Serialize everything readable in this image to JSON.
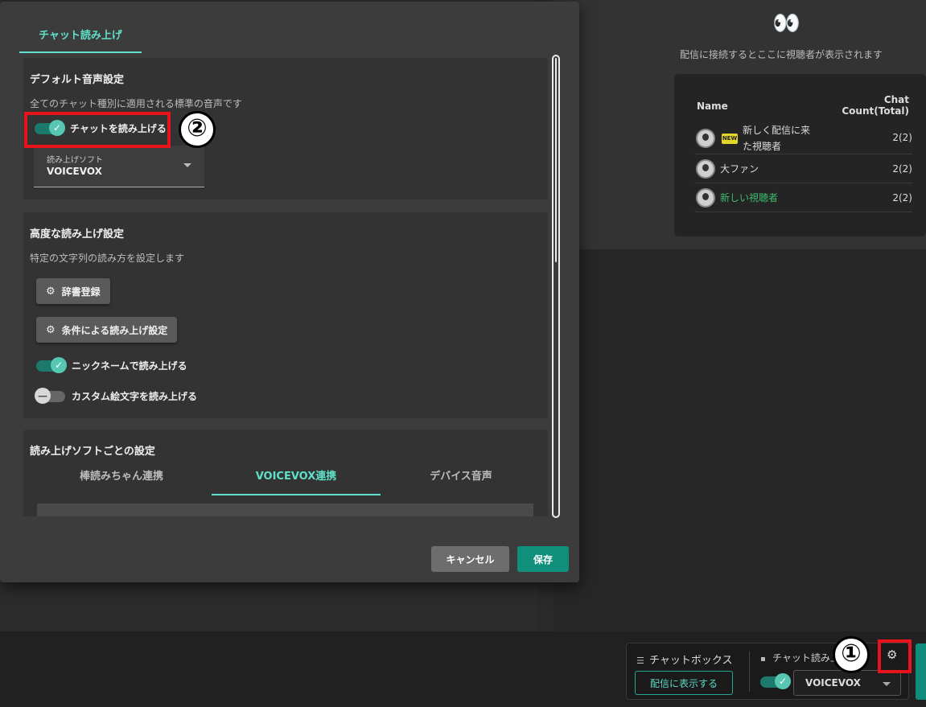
{
  "viewer_panel": {
    "empty_icon": "👀",
    "empty_message": "配信に接続するとここに視聴者が表示されます",
    "col_name": "Name",
    "col_count_line1": "Chat",
    "col_count_line2": "Count(Total)",
    "rows": [
      {
        "badge": "NEW",
        "name_line1": "新しく配信に来",
        "name_line2": "た視聴者",
        "count": "2(2)"
      },
      {
        "name": "大ファン",
        "count": "2(2)"
      },
      {
        "name": "新しい視聴者",
        "count": "2(2)",
        "color": "#3dbb6d"
      }
    ]
  },
  "footer": {
    "chatbox_label": "チャットボックス",
    "show_button": "配信に表示する",
    "read_label": "チャット読み上げ",
    "read_toggle_on": true,
    "engine_value": "VOICEVOX",
    "settings_icon": "gear-icon"
  },
  "modal": {
    "tab": "チャット読み上げ",
    "default_section": {
      "title": "デフォルト音声設定",
      "desc": "全てのチャット種別に適用される標準の音声です",
      "toggle_label": "チャットを読み上げる",
      "toggle_on": true,
      "select_label": "読み上げソフト",
      "select_value": "VOICEVOX"
    },
    "advanced_section": {
      "title": "高度な読み上げ設定",
      "desc": "特定の文字列の読み方を設定します",
      "dict_button": "辞書登録",
      "condition_button": "条件による読み上げ設定",
      "nickname_toggle": "ニックネームで読み上げる",
      "nickname_on": true,
      "emoji_toggle": "カスタム絵文字を読み上げる",
      "emoji_on": false
    },
    "engine_section": {
      "title": "読み上げソフトごとの設定",
      "tabs": [
        "棒読みちゃん連携",
        "VOICEVOX連携",
        "デバイス音声"
      ],
      "active_tab": 1
    },
    "cancel": "キャンセル",
    "save": "保存"
  },
  "annotations": {
    "marker1": "①",
    "marker2": "②",
    "highlight_color": "#e8131b"
  },
  "colors": {
    "accent": "#5fe0c9",
    "toggle_track": "#1c7a6c",
    "save_button": "#10907c"
  }
}
